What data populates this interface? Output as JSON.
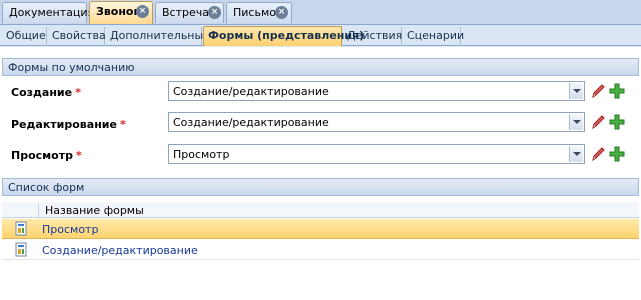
{
  "doc_tabs": [
    {
      "label": "Документация",
      "closable": false,
      "active": false
    },
    {
      "label": "Звонок",
      "closable": true,
      "active": true
    },
    {
      "label": "Встреча",
      "closable": true,
      "active": false
    },
    {
      "label": "Письмо",
      "closable": true,
      "active": false
    }
  ],
  "sub_tabs": [
    {
      "label": "Общие",
      "active": false
    },
    {
      "label": "Свойства",
      "active": false
    },
    {
      "label": "Дополнительные",
      "active": false
    },
    {
      "label": "Формы (представления)",
      "active": true
    },
    {
      "label": "Действия",
      "active": false
    },
    {
      "label": "Сценарии",
      "active": false
    }
  ],
  "default_forms": {
    "title": "Формы по умолчанию",
    "rows": [
      {
        "label": "Создание",
        "required": "*",
        "value": "Создание/редактирование"
      },
      {
        "label": "Редактирование",
        "required": "*",
        "value": "Создание/редактирование"
      },
      {
        "label": "Просмотр",
        "required": "*",
        "value": "Просмотр"
      }
    ]
  },
  "forms_list": {
    "title": "Список форм",
    "column_header": "Название формы",
    "items": [
      {
        "name": "Просмотр",
        "selected": true
      },
      {
        "name": "Создание/редактирование",
        "selected": false
      }
    ]
  },
  "colors": {
    "accent_selected": "#ffd371",
    "link_text": "#15399a",
    "required_mark": "#d22222"
  },
  "icons": {
    "edit": "pencil-icon",
    "add": "green-plus-icon",
    "form": "form-document-icon"
  }
}
